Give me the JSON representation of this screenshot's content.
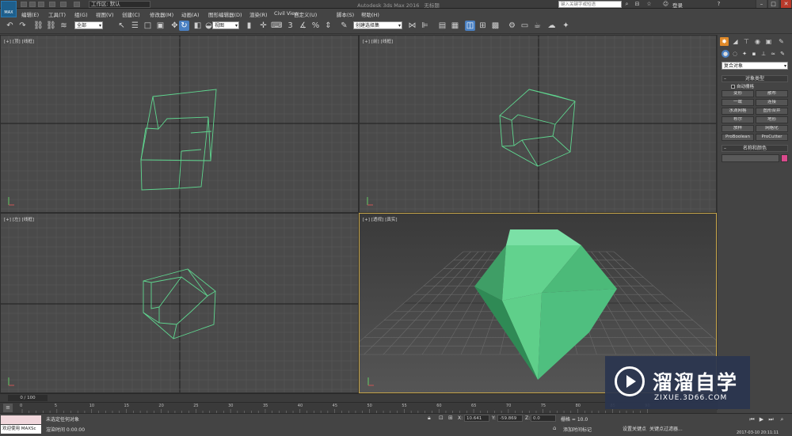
{
  "titlebar": {
    "logo": "MAX",
    "workspace": "工作区: 默认",
    "app_title": "Autodesk 3ds Max 2016",
    "file_name": "无标题",
    "search_placeholder": "键入关键字或短语",
    "login": "登录"
  },
  "menu": [
    "编辑(E)",
    "工具(T)",
    "组(G)",
    "视图(V)",
    "创建(C)",
    "修改器(M)",
    "动画(A)",
    "图形编辑器(D)",
    "渲染(R)",
    "Civil View",
    "自定义(U)",
    "脚本(S)",
    "帮助(H)"
  ],
  "toolbar": {
    "selection_filter": "全部",
    "ref_coord": "视图",
    "named_selection": "创建选择集"
  },
  "viewports": {
    "top": [
      "[+]",
      "[顶]",
      "[线框]"
    ],
    "front": [
      "[+]",
      "[前]",
      "[线框]"
    ],
    "left": [
      "[+]",
      "[左]",
      "[线框]"
    ],
    "persp": [
      "[+]",
      "[透视]",
      "[真实]"
    ]
  },
  "command_panel": {
    "category": "复合对象",
    "object_type_header": "对象类型",
    "autogrid": "自动栅格",
    "buttons": [
      "变形",
      "散布",
      "一致",
      "连接",
      "水滴网格",
      "图形合并",
      "布尔",
      "地形",
      "放样",
      "网格化",
      "ProBoolean",
      "ProCutter"
    ],
    "name_color_header": "名称和颜色"
  },
  "timeline": {
    "frame": "0 / 100",
    "ticks": [
      "0",
      "5",
      "10",
      "15",
      "20",
      "25",
      "30",
      "35",
      "40",
      "45",
      "50",
      "55",
      "60",
      "65",
      "70",
      "75",
      "80",
      "85",
      "90"
    ]
  },
  "status": {
    "welcome": "欢迎使用 MAXSc",
    "selection": "未选定任何对象",
    "render_time": "渲染时间 0:00:00",
    "x_label": "X:",
    "x_value": "10.641",
    "y_label": "Y:",
    "y_value": "-59.869",
    "z_label": "Z:",
    "z_value": "0.0",
    "grid": "栅格 = 10.0",
    "add_time_tag": "添加时间标记",
    "set_key": "设置关键点",
    "key_filters": "关键点过滤器...",
    "clock": "2017-03-10  20:11:11"
  },
  "watermark": {
    "name": "溜溜自学",
    "url": "ZIXUE.3D66.COM"
  },
  "colors": {
    "wireframe": "#5fd68f",
    "shape_light": "#5fcf8a",
    "shape_dark": "#2f8a55",
    "viewport_bg": "#4a4a4a",
    "active_border": "#c8a64a"
  }
}
